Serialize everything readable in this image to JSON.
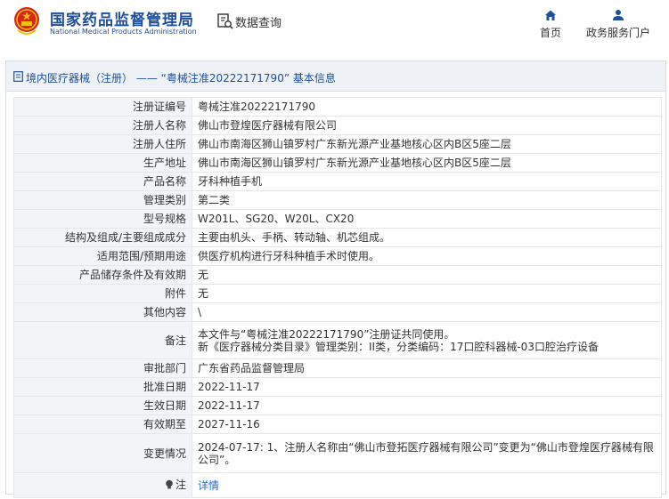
{
  "header": {
    "site_title": "国家药品监督管理局",
    "site_subtitle": "National Medical Products Administration",
    "query_label": "数据查询",
    "nav": [
      {
        "label": "首页",
        "icon": "home-icon"
      },
      {
        "label": "政务服务门户",
        "icon": "user-icon"
      }
    ]
  },
  "breadcrumb": {
    "text": "境内医疗器械（注册） —— “粤械注准20222171790” 基本信息"
  },
  "rows": [
    {
      "label": "注册证编号",
      "value": "粤械注准20222171790"
    },
    {
      "label": "注册人名称",
      "value": "佛山市登煌医疗器械有限公司"
    },
    {
      "label": "注册人住所",
      "value": "佛山市南海区狮山镇罗村广东新光源产业基地核心区内B区5座二层"
    },
    {
      "label": "生产地址",
      "value": "佛山市南海区狮山镇罗村广东新光源产业基地核心区内B区5座二层"
    },
    {
      "label": "产品名称",
      "value": "牙科种植手机"
    },
    {
      "label": "管理类别",
      "value": "第二类"
    },
    {
      "label": "型号规格",
      "value": "W201L、SG20、W20L、CX20"
    },
    {
      "label": "结构及组成/主要组成成分",
      "value": "主要由机头、手柄、转动轴、机芯组成。"
    },
    {
      "label": "适用范围/预期用途",
      "value": "供医疗机构进行牙科种植手术时使用。"
    },
    {
      "label": "产品储存条件及有效期",
      "value": "无"
    },
    {
      "label": "附件",
      "value": "无"
    },
    {
      "label": "其他内容",
      "value": "\\"
    },
    {
      "label": "备注",
      "value": "本文件与“粤械注准20222171790”注册证共同使用。\n新《医疗器械分类目录》管理类别：II类，分类编码：17口腔科器械-03口腔治疗设备"
    },
    {
      "label": "审批部门",
      "value": "广东省药品监督管理局"
    },
    {
      "label": "批准日期",
      "value": "2022-11-17"
    },
    {
      "label": "生效日期",
      "value": "2022-11-17"
    },
    {
      "label": "有效期至",
      "value": "2027-11-16"
    },
    {
      "label": "变更情况",
      "value": "2024-07-17: 1、注册人名称由“佛山市登拓医疗器械有限公司”变更为“佛山市登煌医疗器械有限公司”。"
    }
  ],
  "note": {
    "label": "注",
    "link_text": "详情"
  },
  "colors": {
    "brand_blue": "#1f4e9c",
    "link_blue": "#2b6cc4",
    "label_bg": "#f2f4f7",
    "border": "#e4e7eb"
  }
}
